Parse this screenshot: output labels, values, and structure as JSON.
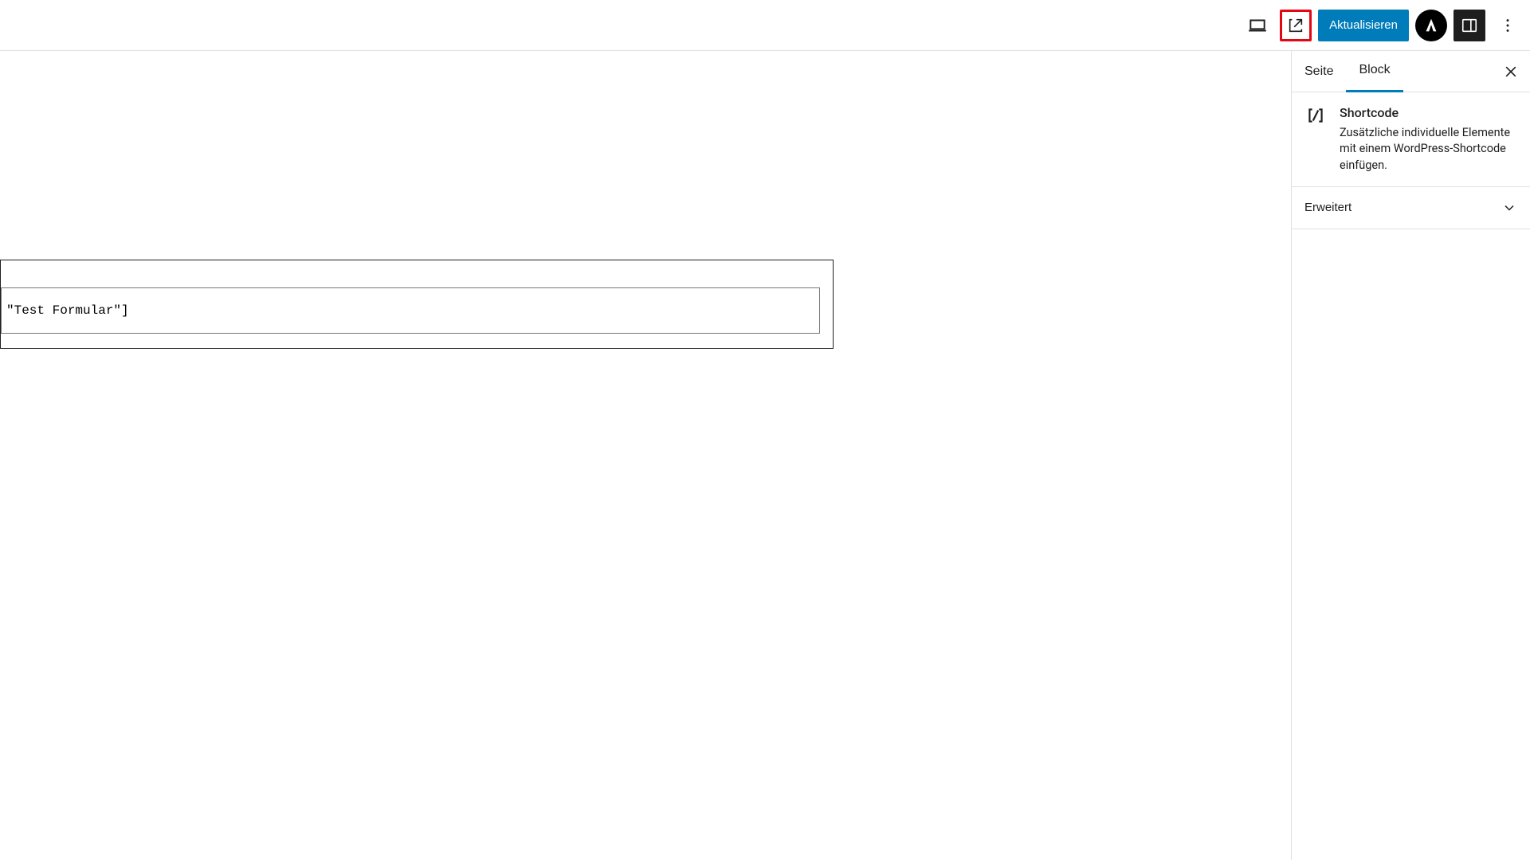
{
  "toolbar": {
    "publish_label": "Aktualisieren"
  },
  "editor": {
    "shortcode_value": "\"Test Formular\"]"
  },
  "sidebar": {
    "tabs": {
      "page": "Seite",
      "block": "Block"
    },
    "block": {
      "title": "Shortcode",
      "description": "Zusätzliche individuelle Elemente mit einem WordPress-Shortcode einfügen."
    },
    "panels": {
      "advanced": "Erweitert"
    }
  }
}
